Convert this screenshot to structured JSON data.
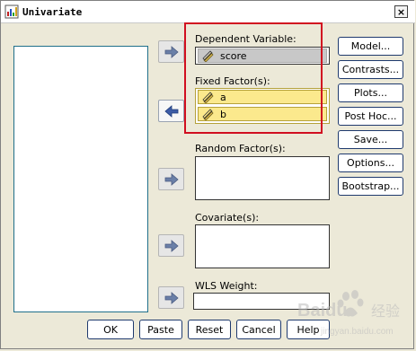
{
  "window": {
    "title": "Univariate",
    "close_label": "×"
  },
  "targets": {
    "dependent_label": "Dependent Variable:",
    "dependent_value": "score",
    "fixed_label": "Fixed Factor(s):",
    "fixed_values": [
      "a",
      "b"
    ],
    "random_label": "Random Factor(s):",
    "covariate_label": "Covariate(s):",
    "wls_label": "WLS Weight:"
  },
  "side_buttons": [
    "Model...",
    "Contrasts...",
    "Plots...",
    "Post Hoc...",
    "Save...",
    "Options...",
    "Bootstrap..."
  ],
  "bottom_buttons": [
    "OK",
    "Paste",
    "Reset",
    "Cancel",
    "Help"
  ],
  "watermark": {
    "brand": "Baidu",
    "sub": "jingyan.baidu.com",
    "glyph": "经验"
  },
  "icons": {
    "title_icon": "dialog-icon",
    "arrow_right": "arrow-right-icon",
    "arrow_left": "arrow-left-icon",
    "variable": "pencil-ruler-icon"
  },
  "colors": {
    "highlight_red": "#d10f20",
    "selected_yellow": "#fbe98d",
    "dep_gray": "#c8c8c8"
  }
}
